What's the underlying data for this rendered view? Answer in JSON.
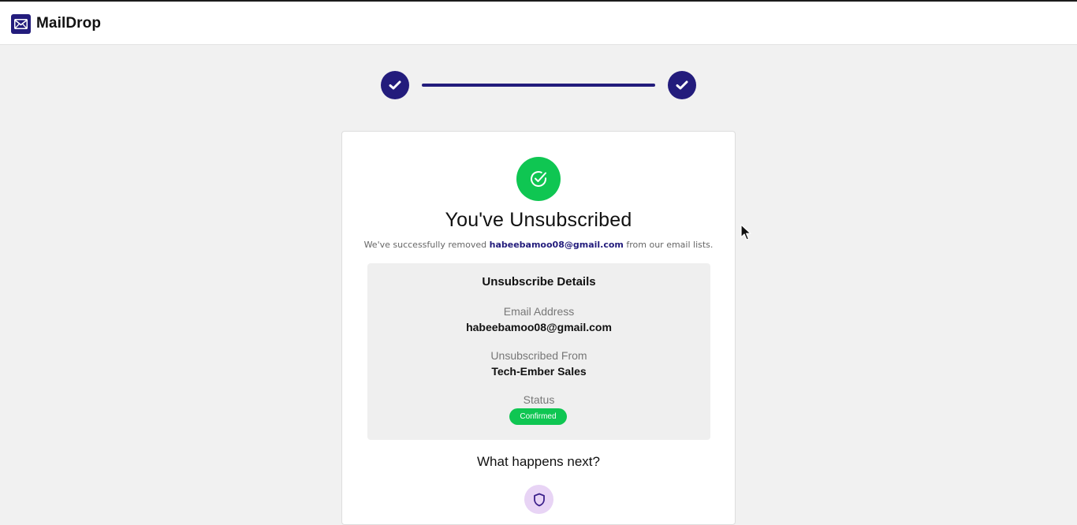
{
  "header": {
    "brand_name": "MailDrop",
    "brand_icon": "mail-icon"
  },
  "stepper": {
    "steps": [
      {
        "icon": "check-icon",
        "state": "complete"
      },
      {
        "icon": "check-icon",
        "state": "complete"
      }
    ],
    "progress": 1.0
  },
  "result": {
    "icon": "check-circle-icon",
    "title": "You've Unsubscribed",
    "subtitle_prefix": "We've successfully removed",
    "subtitle_email": "habeebamoo08@gmail.com",
    "subtitle_suffix": "from our email lists."
  },
  "details": {
    "title": "Unsubscribe Details",
    "email_label": "Email Address",
    "email_value": "habeebamoo08@gmail.com",
    "from_label": "Unsubscribed From",
    "from_value": "Tech-Ember Sales",
    "status_label": "Status",
    "status_value": "Confirmed"
  },
  "next": {
    "title": "What happens next?",
    "icon": "shield-icon"
  },
  "colors": {
    "brand": "#231c7c",
    "success": "#0fc652",
    "page_bg": "#f1f1f1",
    "shield_bg": "#e8d4f5"
  }
}
